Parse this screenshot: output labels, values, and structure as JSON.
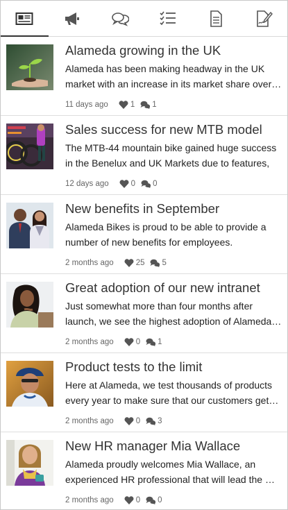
{
  "tabs": [
    {
      "icon": "news-icon",
      "active": true
    },
    {
      "icon": "megaphone-icon",
      "active": false
    },
    {
      "icon": "chat-bubbles-icon",
      "active": false
    },
    {
      "icon": "checklist-icon",
      "active": false
    },
    {
      "icon": "document-icon",
      "active": false
    },
    {
      "icon": "sign-document-icon",
      "active": false
    }
  ],
  "items": [
    {
      "title": "Alameda growing in the UK",
      "desc": "Alameda has been making headway in the UK market with an increase in its market share over the last year",
      "date": "11 days ago",
      "likes": "1",
      "comments": "1"
    },
    {
      "title": "Sales success for new MTB model",
      "desc": "The MTB-44 mountain bike gained huge success in the Benelux and UK Markets due to features,",
      "date": "12 days ago",
      "likes": "0",
      "comments": "0"
    },
    {
      "title": "New benefits in September",
      "desc": "Alameda Bikes is proud to be able to provide a number of new benefits for employees.",
      "date": "2 months ago",
      "likes": "25",
      "comments": "5"
    },
    {
      "title": "Great adoption of our new intranet",
      "desc": "Just somewhat more than four months after launch, we see the highest adoption of Alameda's intranet",
      "date": "2 months ago",
      "likes": "0",
      "comments": "1"
    },
    {
      "title": "Product tests to the limit",
      "desc": "Here at Alameda, we test thousands of products every year to make sure that our customers get the best",
      "date": "2 months ago",
      "likes": "0",
      "comments": "3"
    },
    {
      "title": "New HR manager Mia Wallace",
      "desc": "Alameda proudly welcomes Mia Wallace, an experienced HR professional that will lead the HR team",
      "date": "2 months ago",
      "likes": "0",
      "comments": "0"
    }
  ]
}
